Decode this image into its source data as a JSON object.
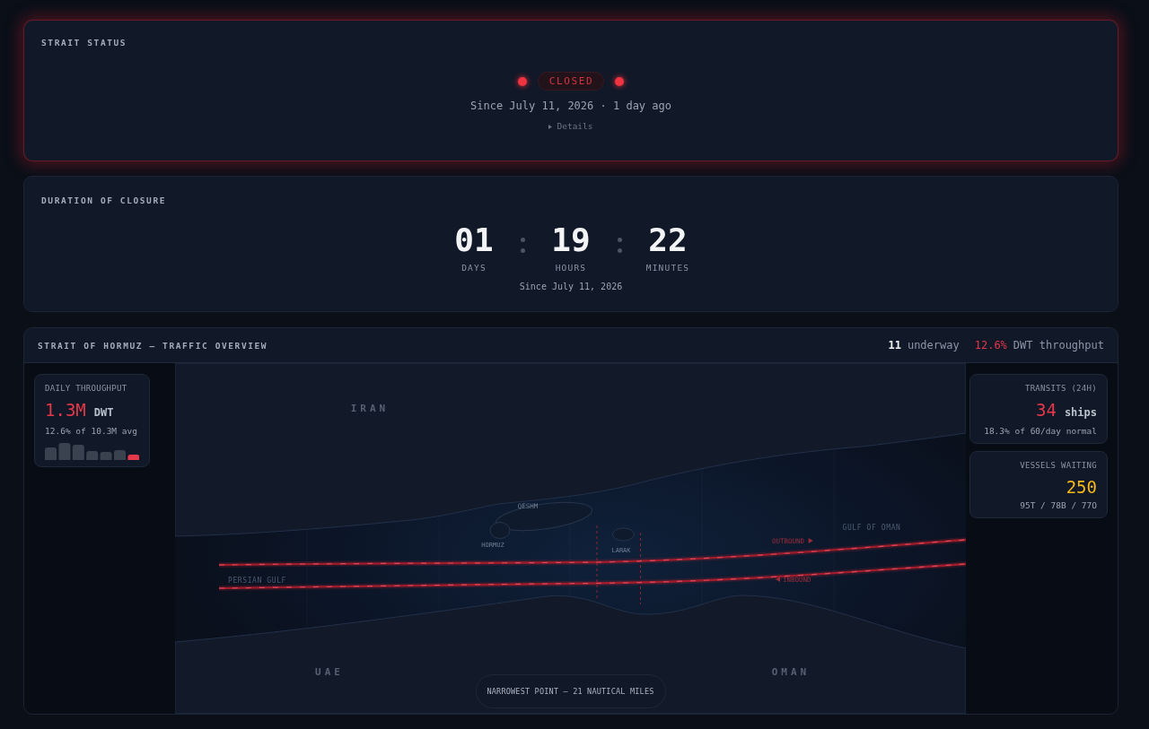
{
  "status_card": {
    "title": "STRAIT STATUS",
    "status": {
      "label": "CLOSED",
      "kind": "closed"
    },
    "since": "Since July 11, 2026 · 1 day ago",
    "details": {
      "label": "Details",
      "expanded": false
    }
  },
  "duration_card": {
    "title": "DURATION OF CLOSURE",
    "units": [
      {
        "value": "01",
        "label": "DAYS"
      },
      {
        "value": "19",
        "label": "HOURS"
      },
      {
        "value": "22",
        "label": "MINUTES"
      }
    ],
    "since": "Since July 11, 2026"
  },
  "traffic_overview": {
    "title": "STRAIT OF HORMUZ — TRAFFIC OVERVIEW",
    "underway": {
      "value": "11",
      "label": "underway"
    },
    "dwt_throughput": {
      "value": "12.6%",
      "label": "DWT throughput"
    },
    "daily_throughput": {
      "title": "DAILY THROUGHPUT",
      "value": "1.3M",
      "unit": "DWT",
      "note": "12.6% of 10.3M avg",
      "kind": "critical"
    },
    "map": {
      "countries": [
        "IRAN",
        "UAE",
        "OMAN"
      ],
      "islands": [
        "QESHM",
        "HORMUZ",
        "LARAK"
      ],
      "waters": [
        "GULF OF OMAN",
        "PERSIAN GULF"
      ],
      "lanes": [
        {
          "label": "OUTBOUND",
          "kind": "outbound"
        },
        {
          "label": "INBOUND",
          "kind": "inbound"
        }
      ],
      "narrowest_point": "NARROWEST POINT — 21 NAUTICAL MILES"
    },
    "side_stats": [
      {
        "title": "TRANSITS (24H)",
        "value": "34",
        "unit": "ships",
        "note": "18.3% of 60/day normal",
        "kind": "critical"
      },
      {
        "title": "VESSELS WAITING",
        "value": "250",
        "note": "95T / 78B / 77O",
        "kind": "warning"
      }
    ]
  }
}
